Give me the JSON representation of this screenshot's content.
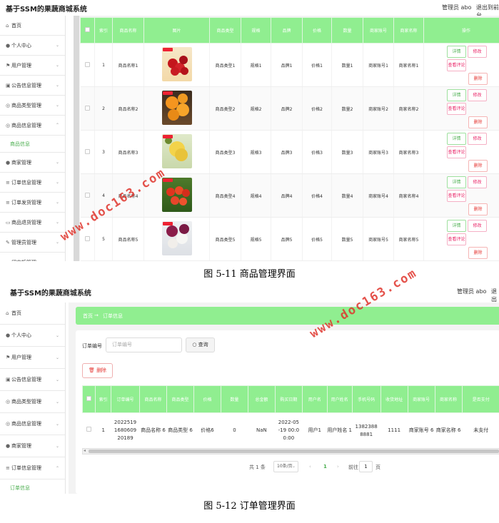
{
  "top": {
    "app_title": "基于SSM的果蔬商城系统",
    "user_role_1": "管理员 abo",
    "logout_1": "退出到前台",
    "user_role_2": "管理员 abo",
    "logout_2": "退出到前台"
  },
  "sidebar1": {
    "items": [
      {
        "icon": "home-icon",
        "label": "首页"
      },
      {
        "icon": "user-icon",
        "label": "个人中心"
      },
      {
        "icon": "flag-icon",
        "label": "用户管理"
      },
      {
        "icon": "notice-icon",
        "label": "公告信息管理"
      },
      {
        "icon": "circle-icon",
        "label": "商品类型管理"
      },
      {
        "icon": "circle-icon",
        "label": "商品信息管理"
      },
      {
        "icon": "user-icon",
        "label": "商家管理"
      },
      {
        "icon": "menu-icon",
        "label": "订单信息管理"
      },
      {
        "icon": "menu-icon",
        "label": "订单发货管理"
      },
      {
        "icon": "comment-icon",
        "label": "商品退货管理"
      },
      {
        "icon": "edit-icon",
        "label": "管理员管理"
      },
      {
        "icon": "comment-icon",
        "label": "留言板管理"
      }
    ],
    "sub_item": "商品信息"
  },
  "table1": {
    "headers": [
      "全选",
      "索引",
      "商品名称",
      "图片",
      "商品类型",
      "规格",
      "品牌",
      "价格",
      "数量",
      "商家账号",
      "商家名称",
      "操作"
    ],
    "rows": [
      {
        "index": "1",
        "name": "商品名称1",
        "type": "商品类型1",
        "spec": "规格1",
        "brand": "品牌1",
        "price": "价格1",
        "qty": "数量1",
        "account": "商家账号1",
        "merchant": "商家名称1"
      },
      {
        "index": "2",
        "name": "商品名称2",
        "type": "商品类型2",
        "spec": "规格2",
        "brand": "品牌2",
        "price": "价格2",
        "qty": "数量2",
        "account": "商家账号2",
        "merchant": "商家名称2"
      },
      {
        "index": "3",
        "name": "商品名称3",
        "type": "商品类型3",
        "spec": "规格3",
        "brand": "品牌3",
        "price": "价格3",
        "qty": "数量3",
        "account": "商家账号3",
        "merchant": "商家名称3"
      },
      {
        "index": "4",
        "name": "商品名称4",
        "type": "商品类型4",
        "spec": "规格4",
        "brand": "品牌4",
        "price": "价格4",
        "qty": "数量4",
        "account": "商家账号4",
        "merchant": "商家名称4"
      },
      {
        "index": "5",
        "name": "商品名称5",
        "type": "商品类型5",
        "spec": "规格5",
        "brand": "品牌5",
        "price": "价格5",
        "qty": "数量5",
        "account": "商家账号5",
        "merchant": "商家名称5"
      }
    ],
    "btn_detail": "详情",
    "btn_edit": "修改",
    "btn_review": "查看评论",
    "btn_delete": "删除"
  },
  "captions": {
    "fig1": "图 5-11 商品管理界面",
    "fig2": "图 5-12 订单管理界面"
  },
  "watermark": "www.doc163.com",
  "sidebar2": {
    "items": [
      {
        "icon": "home-icon",
        "label": "首页"
      },
      {
        "icon": "user-icon",
        "label": "个人中心"
      },
      {
        "icon": "flag-icon",
        "label": "用户管理"
      },
      {
        "icon": "notice-icon",
        "label": "公告信息管理"
      },
      {
        "icon": "circle-icon",
        "label": "商品类型管理"
      },
      {
        "icon": "circle-icon",
        "label": "商品信息管理"
      },
      {
        "icon": "user-icon",
        "label": "商家管理"
      },
      {
        "icon": "menu-icon",
        "label": "订单信息管理"
      }
    ],
    "sub_item": "订单信息"
  },
  "order_page": {
    "breadcrumb_home": "首页",
    "breadcrumb_sep": "→",
    "breadcrumb_current": "订单信息",
    "search_label": "订单编号",
    "search_placeholder": "订单编号",
    "query_button": "查询",
    "delete_button": "删除",
    "headers": [
      "全选",
      "索引",
      "订单编号",
      "商品名称",
      "商品类型",
      "价格",
      "数量",
      "总金额",
      "购买日期",
      "用户名",
      "用户姓名",
      "手机号码",
      "收货地址",
      "商家账号",
      "商家名称",
      "是否支付"
    ],
    "row": {
      "index": "1",
      "order_no": "2022519 1680609 20189",
      "name": "商品名称 6",
      "type": "商品类型 6",
      "price": "价格6",
      "qty": "0",
      "total": "NaN",
      "date": "2022-05 -19 00:0 0:00",
      "username": "用户1",
      "realname": "用户姓名 1",
      "phone": "1382388 8881",
      "address": "1111",
      "account": "商家账号 6",
      "merchant": "商家名称 6",
      "paid": "未支付"
    },
    "pager_total": "共 1 条",
    "pager_size": "10条/页",
    "pager_prev": "‹",
    "pager_current": "1",
    "pager_next": "›",
    "pager_goto": "前往",
    "pager_goto_value": "1",
    "pager_page_unit": "页"
  }
}
